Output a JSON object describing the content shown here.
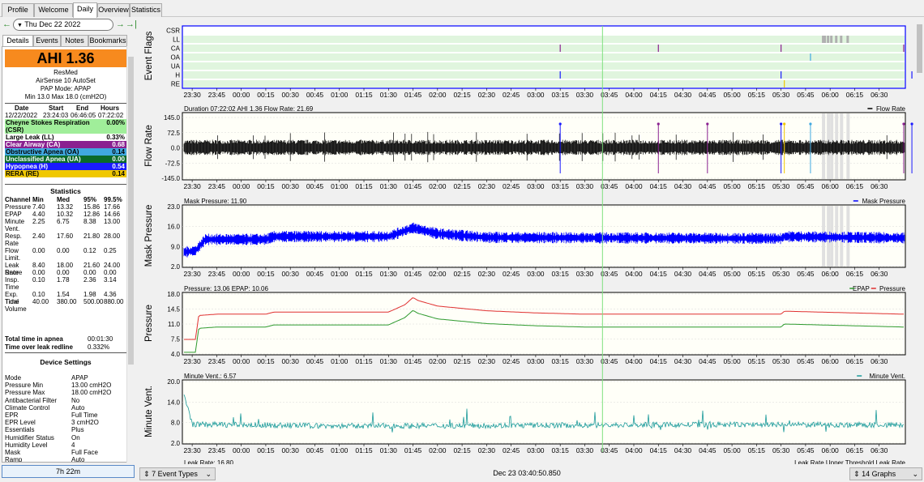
{
  "menu_tabs": [
    "Profile",
    "Welcome",
    "Daily",
    "Overview",
    "Statistics"
  ],
  "nav": {
    "prev_icon": "←",
    "date": "Thu Dec 22 2022",
    "next_icon": "→",
    "last_icon": "→|"
  },
  "side_tabs": [
    "Details",
    "Events",
    "Notes",
    "Bookmarks"
  ],
  "summary": {
    "ahi": "AHI 1.36",
    "ahi_color": "#f78a1e",
    "brand": "ResMed",
    "model": "AirSense 10 AutoSet",
    "pap_mode": "PAP Mode: APAP",
    "pressure_range": "Min 13.0 Max 18.0 (cmH2O)"
  },
  "session_table": {
    "headers": [
      "Date",
      "Start",
      "End",
      "Hours"
    ],
    "row": [
      "12/22/2022",
      "23:24:03",
      "06:46:05",
      "07:22:02"
    ]
  },
  "events": [
    {
      "label": "Cheyne Stokes Respiration (CSR)",
      "value": "0.00%",
      "color": "#a0ee9a",
      "text_color": "#000000"
    },
    {
      "label": "Large Leak (LL)",
      "value": "0.33%",
      "color": "#ffffff",
      "text_color": "#000000"
    },
    {
      "label": "Clear Airway (CA)",
      "value": "0.68",
      "color": "#8a2090",
      "text_color": "#ffffff"
    },
    {
      "label": "Obstructive Apnea (OA)",
      "value": "0.14",
      "color": "#40a8e0",
      "text_color": "#000000"
    },
    {
      "label": "Unclassified Apnea (UA)",
      "value": "0.00",
      "color": "#0a6a2a",
      "text_color": "#ffffff"
    },
    {
      "label": "Hypopnea (H)",
      "value": "0.54",
      "color": "#1a1aff",
      "text_color": "#ffffff"
    },
    {
      "label": "RERA (RE)",
      "value": "0.14",
      "color": "#f0c800",
      "text_color": "#000000"
    }
  ],
  "statistics": {
    "title": "Statistics",
    "headers": [
      "Channel",
      "Min",
      "Med",
      "95%",
      "99.5%"
    ],
    "rows": [
      {
        "name": "Pressure",
        "cells": [
          "7.40",
          "13.32",
          "15.86",
          "17.66"
        ]
      },
      {
        "name": "EPAP",
        "cells": [
          "4.40",
          "10.32",
          "12.86",
          "14.66"
        ]
      },
      {
        "name": "Minute Vent.",
        "cells": [
          "2.25",
          "6.75",
          "8.38",
          "13.00"
        ]
      },
      {
        "name": "Resp. Rate",
        "cells": [
          "2.40",
          "17.60",
          "21.80",
          "28.00"
        ]
      },
      {
        "name": "Flow Limit.",
        "cells": [
          "0.00",
          "0.00",
          "0.12",
          "0.25"
        ]
      },
      {
        "name": "Leak Rate",
        "cells": [
          "8.40",
          "18.00",
          "21.60",
          "24.00"
        ]
      },
      {
        "name": "Snore",
        "cells": [
          "0.00",
          "0.00",
          "0.00",
          "0.00"
        ]
      },
      {
        "name": "Insp. Time",
        "cells": [
          "0.10",
          "1.78",
          "2.36",
          "3.14"
        ]
      },
      {
        "name": "Exp. Time",
        "cells": [
          "0.10",
          "1.54",
          "1.98",
          "4.36"
        ]
      },
      {
        "name": "Tidal Volume",
        "cells": [
          "40.00",
          "380.00",
          "500.00",
          "880.00"
        ]
      }
    ],
    "apnea_label": "Total time in apnea",
    "apnea_value": "00:01:30",
    "leak_label": "Time over leak redline",
    "leak_value": "0.332%"
  },
  "device_settings": {
    "title": "Device Settings",
    "rows": [
      {
        "name": "Mode",
        "value": "APAP"
      },
      {
        "name": "Pressure Min",
        "value": "13.00 cmH2O"
      },
      {
        "name": "Pressure Max",
        "value": "18.00 cmH2O"
      },
      {
        "name": "Antibacterial Filter",
        "value": "No"
      },
      {
        "name": "Climate Control",
        "value": "Auto"
      },
      {
        "name": "EPR",
        "value": "Full Time"
      },
      {
        "name": "EPR Level",
        "value": "3 cmH2O"
      },
      {
        "name": "Essentials",
        "value": "Plus"
      },
      {
        "name": "Humidifier Status",
        "value": "On"
      },
      {
        "name": "Humidity Level",
        "value": "4"
      },
      {
        "name": "Mask",
        "value": "Full Face"
      },
      {
        "name": "Ramp",
        "value": "Auto"
      }
    ]
  },
  "duration_total": "7h 22m",
  "bottom": {
    "event_types": "7 Event Types",
    "timestamp": "Dec 23 03:40:50.850",
    "graphs": "14 Graphs"
  },
  "time_ticks": [
    "23:30",
    "23:45",
    "00:00",
    "00:15",
    "00:30",
    "00:45",
    "01:00",
    "01:15",
    "01:30",
    "01:45",
    "02:00",
    "02:15",
    "02:30",
    "02:45",
    "03:00",
    "03:15",
    "03:30",
    "03:45",
    "04:00",
    "04:15",
    "04:30",
    "04:45",
    "05:00",
    "05:15",
    "05:30",
    "05:45",
    "06:00",
    "06:15",
    "06:30"
  ],
  "graphs": {
    "event_flags": {
      "axis_title": "Event Flags",
      "rows": [
        "CSR",
        "LL",
        "CA",
        "OA",
        "UA",
        "H",
        "RE"
      ],
      "marks": [
        {
          "row": "LL",
          "times": [
            "05:55",
            "05:56",
            "05:58",
            "06:00",
            "06:03",
            "06:06",
            "06:10"
          ],
          "color": "#b0b0b0"
        },
        {
          "row": "CA",
          "times": [
            "03:15",
            "04:15",
            "05:30",
            "06:45",
            "06:53",
            "06:55"
          ],
          "color": "#8a2090"
        },
        {
          "row": "OA",
          "times": [
            "05:48"
          ],
          "color": "#40a8e0"
        },
        {
          "row": "H",
          "times": [
            "03:15",
            "05:30",
            "06:50",
            "06:53"
          ],
          "color": "#1a1aff"
        },
        {
          "row": "RE",
          "times": [
            "05:32"
          ],
          "color": "#f0c800"
        }
      ]
    },
    "flow_rate": {
      "axis_title": "Flow Rate",
      "header": "Duration 07:22:02 AHI 1.36 Flow Rate: 21.69",
      "legend": "Flow Rate",
      "y_ticks": [
        "145.0",
        "72.5",
        "0.0",
        "-72.5",
        "-145.0"
      ]
    },
    "mask_pressure": {
      "axis_title": "Mask Pressure",
      "header": "Mask Pressure: 11.90",
      "legend": "Mask Pressure",
      "y_ticks": [
        "23.0",
        "16.0",
        "9.0",
        "2.0"
      ]
    },
    "pressure": {
      "axis_title": "Pressure",
      "header": "Pressure: 13.06 EPAP: 10.06",
      "legend_epap": "EPAP",
      "legend_pressure": "Pressure",
      "y_ticks": [
        "18.0",
        "14.5",
        "11.0",
        "7.5",
        "4.0"
      ]
    },
    "minute_vent": {
      "axis_title": "Minute Vent.",
      "header": "Minute Vent.: 6.57",
      "legend": "Minute Vent.",
      "y_ticks": [
        "20.0",
        "14.0",
        "8.0",
        "2.0"
      ]
    },
    "leak_rate": {
      "header": "Leak Rate: 16.80",
      "legend": "Leak Rate Upper Threshold  Leak Rate"
    }
  },
  "cursor_time": "03:40:50",
  "colors": {
    "flag_band": "#e0f5de",
    "plot_bg": "#fffff8",
    "cursor": "#7ee07e",
    "flow": "#000000",
    "mask_pressure": "#0000ff",
    "pressure": "#e03030",
    "epap": "#2e9a2e",
    "minute_vent": "#1a9a9a"
  },
  "chart_data": [
    {
      "type": "line",
      "title": "Pressure",
      "series": [
        {
          "name": "Pressure",
          "x": [
            "23:24",
            "23:32",
            "23:34",
            "23:45",
            "00:15",
            "00:20",
            "01:30",
            "01:40",
            "01:45",
            "01:48",
            "02:00",
            "02:30",
            "03:00",
            "03:30",
            "05:30",
            "05:32",
            "06:45"
          ],
          "values": [
            7.4,
            7.4,
            13.0,
            13.3,
            13.3,
            13.8,
            13.8,
            15.5,
            17.2,
            16.5,
            15.2,
            14.1,
            13.6,
            13.3,
            13.3,
            14.0,
            13.3
          ]
        },
        {
          "name": "EPAP",
          "x": [
            "23:24",
            "23:32",
            "23:34",
            "23:45",
            "00:15",
            "00:20",
            "01:30",
            "01:40",
            "01:45",
            "01:48",
            "02:00",
            "02:30",
            "03:00",
            "03:30",
            "05:30",
            "05:32",
            "06:45"
          ],
          "values": [
            4.4,
            4.4,
            10.0,
            10.3,
            10.3,
            10.8,
            10.8,
            12.5,
            14.2,
            13.5,
            12.2,
            11.1,
            10.6,
            10.3,
            10.3,
            11.0,
            10.3
          ]
        }
      ],
      "ylim": [
        4.0,
        18.0
      ]
    },
    {
      "type": "line",
      "title": "Mask Pressure",
      "series": [
        {
          "name": "Mask Pressure",
          "x": [
            "23:24",
            "23:32",
            "23:38",
            "00:15",
            "00:20",
            "01:30",
            "01:45",
            "02:00",
            "02:30",
            "05:30",
            "05:32",
            "06:45"
          ],
          "values": [
            7.0,
            7.5,
            11.5,
            11.5,
            12.5,
            12.5,
            15.5,
            13.5,
            12.2,
            11.8,
            12.5,
            12.0
          ]
        }
      ],
      "ylim": [
        2.0,
        23.0
      ]
    },
    {
      "type": "line",
      "title": "Minute Vent.",
      "series": [
        {
          "name": "Minute Vent.",
          "x": [
            "23:24",
            "23:30",
            "01:00",
            "03:00",
            "05:00",
            "06:45"
          ],
          "values": [
            18.0,
            7.5,
            7.0,
            7.2,
            7.4,
            7.3
          ]
        }
      ],
      "ylim": [
        2.0,
        20.0
      ]
    }
  ]
}
